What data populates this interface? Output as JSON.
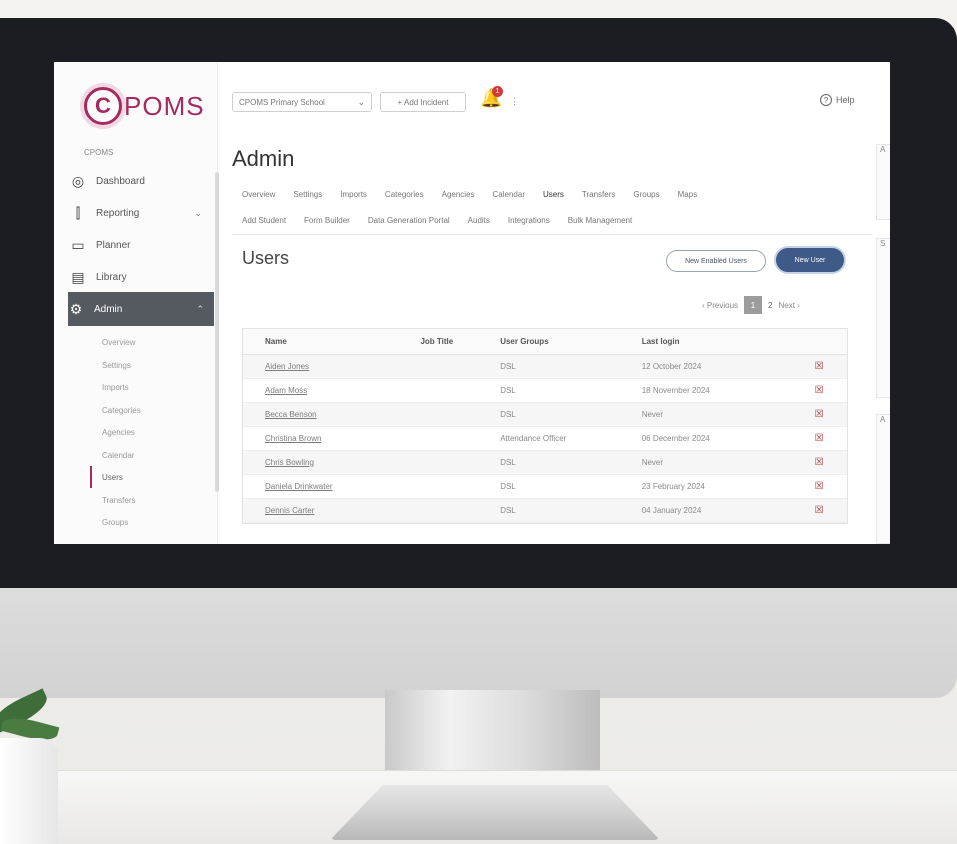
{
  "logo": {
    "mark": "C",
    "text": "POMS",
    "brand_color": "#a52a5e"
  },
  "sidebar": {
    "school_label": "CPOMS",
    "items": [
      {
        "label": "Dashboard",
        "icon": "dashboard-icon"
      },
      {
        "label": "Reporting",
        "icon": "chart-icon",
        "chevron": "⌄"
      },
      {
        "label": "Planner",
        "icon": "calendar-icon"
      },
      {
        "label": "Library",
        "icon": "library-icon"
      },
      {
        "label": "Admin",
        "icon": "gear-icon",
        "chevron": "⌃"
      }
    ],
    "sub_items": [
      "Overview",
      "Settings",
      "Imports",
      "Categories",
      "Agencies",
      "Calendar",
      "Users",
      "Transfers",
      "Groups"
    ]
  },
  "topbar": {
    "school_select": "CPOMS Primary School",
    "add_incident": "+ Add Incident",
    "notifications_count": "1",
    "help": "Help"
  },
  "main": {
    "title": "Admin",
    "tabs_row1": [
      "Overview",
      "Settings",
      "Imports",
      "Categories",
      "Agencies",
      "Calendar",
      "Users",
      "Transfers",
      "Groups",
      "Maps"
    ],
    "tabs_row2": [
      "Add Student",
      "Form Builder",
      "Data Generation Portal",
      "Audits",
      "Integrations",
      "Bulk Management"
    ],
    "selected_tab": "Users",
    "section_title": "Users",
    "bulk_button": "New Enabled Users",
    "new_button": "New User",
    "pager": {
      "previous": "‹ Previous",
      "current": "1",
      "next_page": "2",
      "next": "Next ›"
    }
  },
  "table": {
    "headers": [
      "Name",
      "Job Title",
      "User Groups",
      "Last login"
    ],
    "rows": [
      {
        "name": "Aiden Jones",
        "job": "",
        "groups": "DSL",
        "login": "12 October 2024"
      },
      {
        "name": "Adam Moss",
        "job": "",
        "groups": "DSL",
        "login": "18 November 2024"
      },
      {
        "name": "Becca Benson",
        "job": "",
        "groups": "DSL",
        "login": "Never"
      },
      {
        "name": "Christina Brown",
        "job": "",
        "groups": "Attendance Officer",
        "login": "06 December 2024"
      },
      {
        "name": "Chris Bowling",
        "job": "",
        "groups": "DSL",
        "login": "Never"
      },
      {
        "name": "Daniela Drinkwater",
        "job": "",
        "groups": "DSL",
        "login": "23 February 2024"
      },
      {
        "name": "Dennis Carter",
        "job": "",
        "groups": "DSL",
        "login": "04 January 2024"
      }
    ],
    "delete_icon": "delete-icon"
  },
  "right_panel": [
    "A",
    "S",
    "A"
  ]
}
